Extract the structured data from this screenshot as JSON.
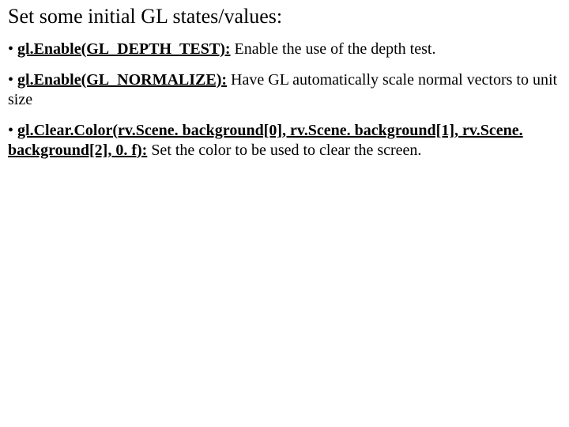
{
  "title": "Set some initial GL states/values:",
  "items": [
    {
      "bullet": "• ",
      "bold_underline": "gl.Enable(GL_DEPTH_TEST):",
      "rest": " Enable the use of the depth test."
    },
    {
      "bullet": "• ",
      "bold_underline": "gl.Enable(GL_NORMALIZE):",
      "rest": " Have GL automatically scale normal vectors to unit size"
    },
    {
      "bullet": "• ",
      "bold_underline": "gl.Clear.Color(rv.Scene. background[0], rv.Scene. background[1], rv.Scene. background[2], 0. f):",
      "rest": " Set the color to be used to clear the screen."
    }
  ]
}
